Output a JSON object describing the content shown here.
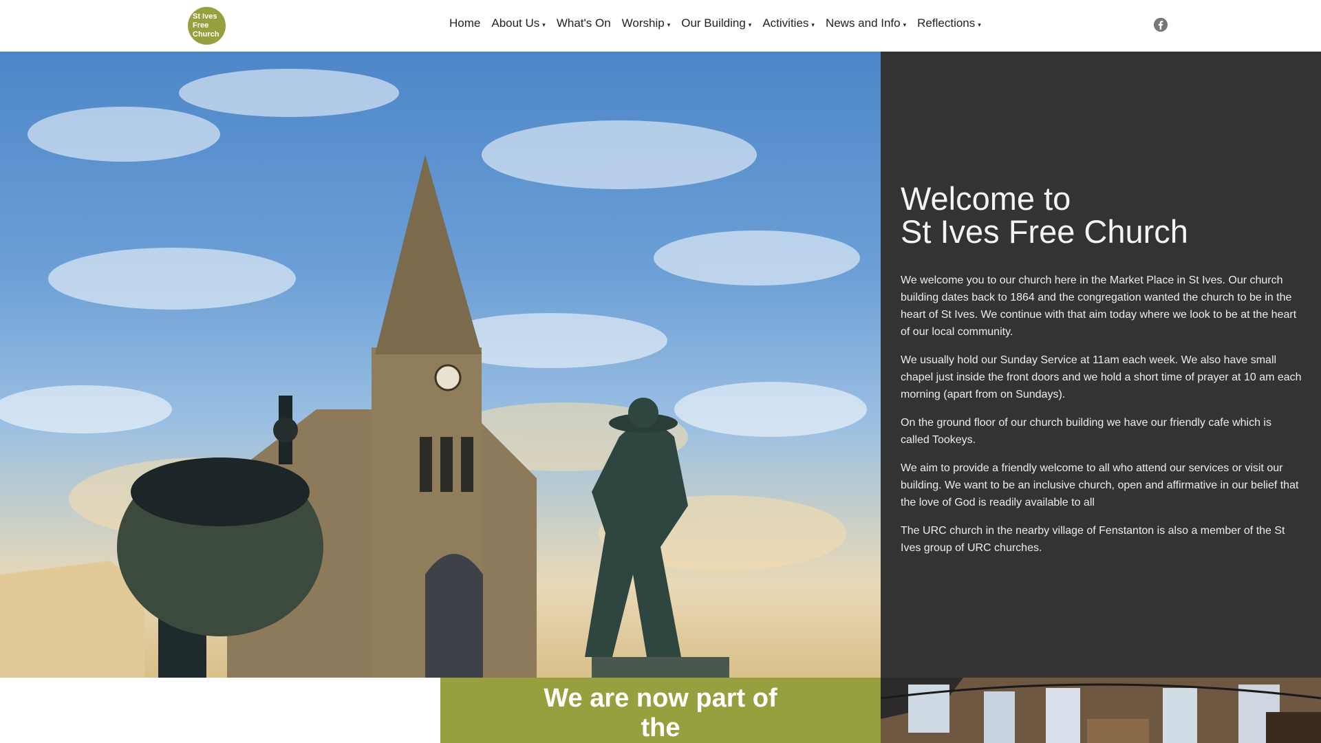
{
  "logo": {
    "lines": [
      "St Ives",
      "Free",
      "Church"
    ]
  },
  "nav": {
    "items": [
      {
        "label": "Home",
        "dropdown": false
      },
      {
        "label": "About Us",
        "dropdown": true
      },
      {
        "label": "What's On",
        "dropdown": false
      },
      {
        "label": "Worship",
        "dropdown": true
      },
      {
        "label": "Our Building",
        "dropdown": true
      },
      {
        "label": "Activities",
        "dropdown": true
      },
      {
        "label": "News and Info",
        "dropdown": true
      },
      {
        "label": "Reflections",
        "dropdown": true
      }
    ],
    "caret": "▾"
  },
  "social": {
    "icon": "facebook-icon"
  },
  "hero": {
    "title_line1": "Welcome to",
    "title_line2": "St Ives Free Church",
    "paragraphs": [
      "We welcome you to our church here in the Market Place in St Ives. Our church building dates back to 1864 and the congregation wanted the church to be in the heart of St Ives. We continue with that aim today where we look to be at the heart of our local community.",
      "We usually hold our Sunday Service at 11am each week.  We also have small chapel just inside the front doors and we hold a short time of prayer at 10 am each morning (apart from on Sundays).",
      "On the ground floor of our church building we have our friendly cafe which is called Tookeys.",
      "We aim to provide a friendly welcome to all who attend our services or visit our building. We want to be an inclusive church, open and affirmative in our belief that the love of God is readily available to all",
      "The URC church in the nearby village of Fenstanton is also a member of the St Ives group of URC churches."
    ]
  },
  "banner": {
    "line1": "We are now part of",
    "line2": "the"
  },
  "colors": {
    "accent": "#97a03f",
    "panel": "#333333"
  }
}
